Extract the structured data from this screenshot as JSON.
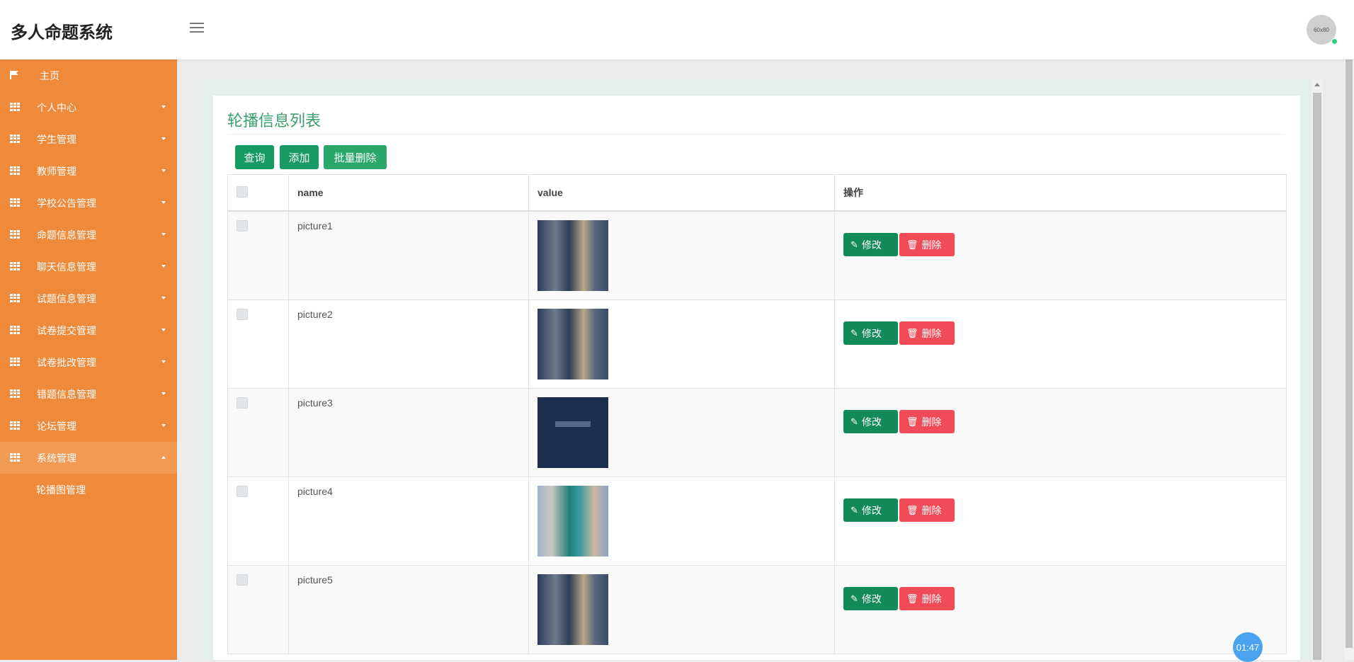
{
  "header": {
    "brand": "多人命题系统",
    "avatar_text": "60x80"
  },
  "sidebar": {
    "items": [
      {
        "label": "主页",
        "icon": "flag-icon"
      },
      {
        "label": "个人中心",
        "icon": "grid-icon"
      },
      {
        "label": "学生管理",
        "icon": "grid-icon"
      },
      {
        "label": "教师管理",
        "icon": "grid-icon"
      },
      {
        "label": "学校公告管理",
        "icon": "grid-icon"
      },
      {
        "label": "命题信息管理",
        "icon": "grid-icon"
      },
      {
        "label": "聊天信息管理",
        "icon": "grid-icon"
      },
      {
        "label": "试题信息管理",
        "icon": "grid-icon"
      },
      {
        "label": "试卷提交管理",
        "icon": "grid-icon"
      },
      {
        "label": "试卷批改管理",
        "icon": "grid-icon"
      },
      {
        "label": "错题信息管理",
        "icon": "grid-icon"
      },
      {
        "label": "论坛管理",
        "icon": "grid-icon"
      },
      {
        "label": "系统管理",
        "icon": "grid-icon"
      }
    ],
    "sub_items": [
      {
        "label": "轮播图管理"
      }
    ],
    "colors": {
      "background": "#ee8a3a",
      "active": "#f29a54"
    }
  },
  "main": {
    "title": "轮播信息列表",
    "toolbar": {
      "query_label": "查询",
      "add_label": "添加",
      "batch_delete_label": "批量删除"
    },
    "table": {
      "headers": [
        "name",
        "value",
        "操作"
      ],
      "rows": [
        {
          "name": "picture1",
          "thumb": "thumb1"
        },
        {
          "name": "picture2",
          "thumb": "thumb1"
        },
        {
          "name": "picture3",
          "thumb": "thumb3"
        },
        {
          "name": "picture4",
          "thumb": "thumb4"
        },
        {
          "name": "picture5",
          "thumb": "thumb1"
        }
      ],
      "edit_label": "修改",
      "delete_label": "删除"
    }
  },
  "timer": {
    "text": "01:47"
  }
}
